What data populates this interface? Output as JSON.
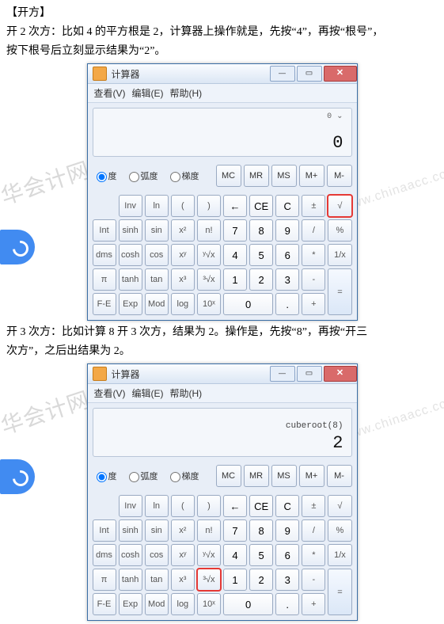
{
  "doc": {
    "heading": "【开方】",
    "p1": "开 2 次方：比如 4 的平方根是 2，计算器上操作就是，先按“4”，再按“根号”，",
    "p2": "按下根号后立刻显示结果为“2”。",
    "p3": "开 3 次方：比如计算 8 开 3 次方，结果为 2。操作是，先按“8”，再按“开三",
    "p4": "次方”，之后出结果为 2。"
  },
  "calc": {
    "title": "计算器",
    "menu": {
      "view": "查看(V)",
      "edit": "编辑(E)",
      "help": "帮助(H)"
    },
    "modes": {
      "deg": "度",
      "rad": "弧度",
      "grad": "梯度"
    },
    "mem": [
      "MC",
      "MR",
      "MS",
      "M+",
      "M-"
    ],
    "row1": [
      "",
      "Inv",
      "ln",
      "(",
      ")",
      "←",
      "CE",
      "C",
      "±",
      "√"
    ],
    "row2": [
      "Int",
      "sinh",
      "sin",
      "x²",
      "n!",
      "7",
      "8",
      "9",
      "/",
      "%"
    ],
    "row3": [
      "dms",
      "cosh",
      "cos",
      "xʸ",
      "ʸ√x",
      "4",
      "5",
      "6",
      "*",
      "1/x"
    ],
    "row4": [
      "π",
      "tanh",
      "tan",
      "x³",
      "³√x",
      "1",
      "2",
      "3",
      "-",
      "="
    ],
    "row5": [
      "F-E",
      "Exp",
      "Mod",
      "log",
      "10ˣ",
      "0",
      "",
      ".",
      "+",
      ""
    ]
  },
  "display1": {
    "m0": "0 ⌄",
    "m1": "",
    "m2": "0"
  },
  "display2": {
    "m0": "",
    "m1": "cuberoot(8)",
    "m2": "2"
  },
  "wm": {
    "brand": "中华会计网校",
    "url": "www.chinaacc.com"
  }
}
